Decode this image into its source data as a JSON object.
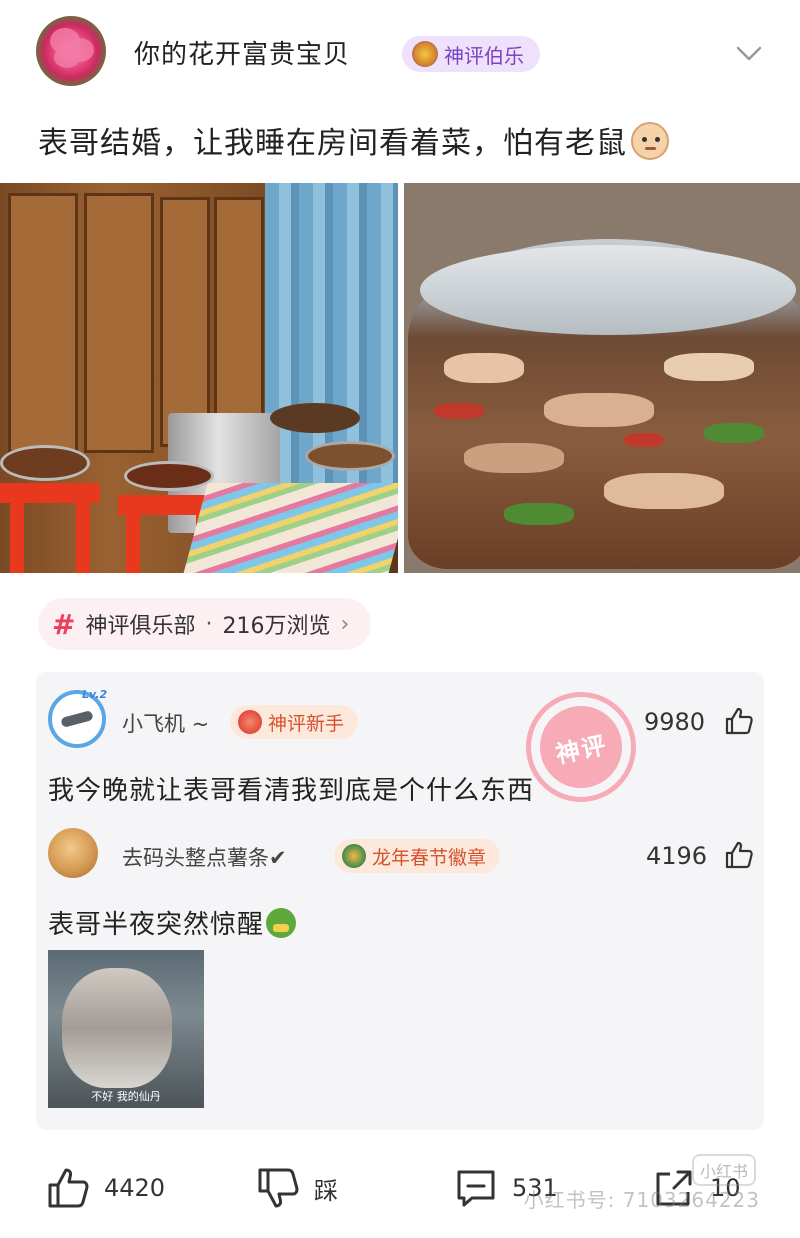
{
  "header": {
    "username": "你的花开富贵宝贝",
    "badge_label": "神评伯乐"
  },
  "post": {
    "title": "表哥结婚，让我睡在房间看着菜，怕有老鼠"
  },
  "topic": {
    "name": "神评俱乐部",
    "separator": "·",
    "views": "216万浏览",
    "chevron": "›"
  },
  "comments": [
    {
      "name": "小飞机 ~",
      "badge": "神评新手",
      "likes": "9980",
      "text": "我今晚就让表哥看清我到底是个什么东西",
      "stamp": "神评"
    },
    {
      "name": "去码头整点薯条✔",
      "badge": "龙年春节徽章",
      "likes": "4196",
      "text": "表哥半夜突然惊醒",
      "image_caption": "不好 我的仙丹"
    }
  ],
  "bottom_bar": {
    "like_count": "4420",
    "dislike_label": "踩",
    "comment_count": "531",
    "share_count": "10",
    "watermark": "小红书号: 7103264223",
    "logo": "小红书"
  },
  "colors": {
    "accent_purple": "#7b42c2",
    "accent_red": "#f03d5c",
    "badge_orange": "#d6522e"
  }
}
